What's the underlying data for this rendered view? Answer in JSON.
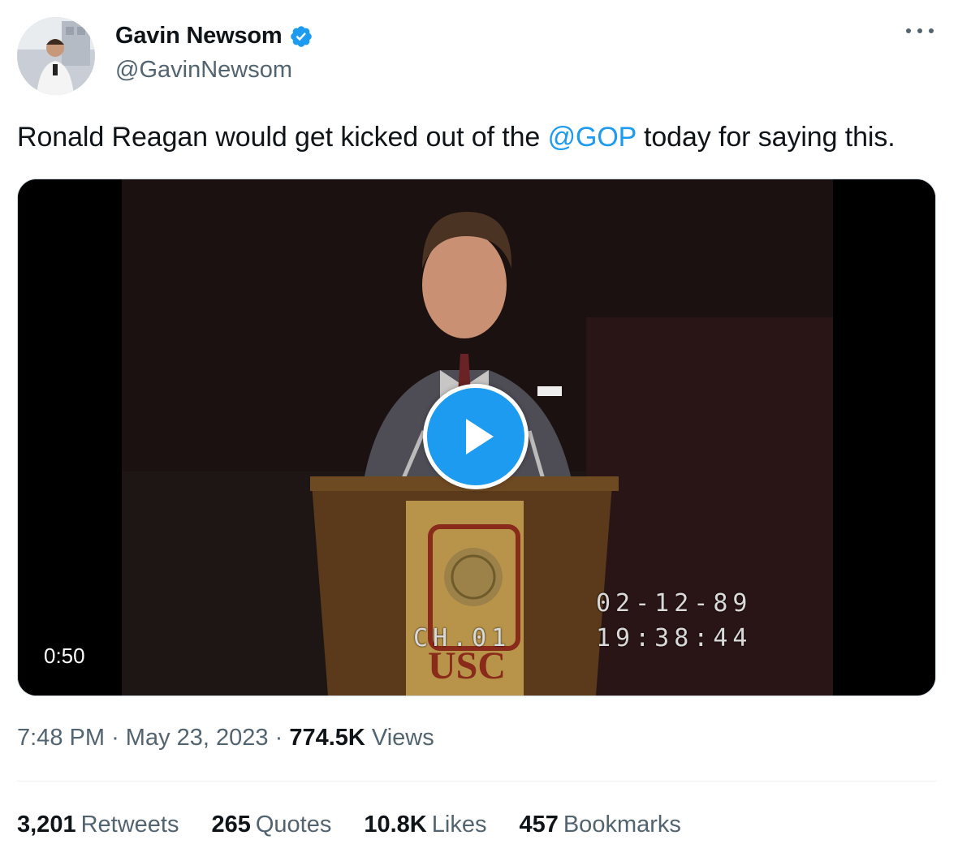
{
  "author": {
    "display_name": "Gavin Newsom",
    "handle": "@GavinNewsom",
    "verified_icon": "verified-badge-icon",
    "avatar_icon": "profile-photo"
  },
  "tweet": {
    "text_before": "Ronald Reagan would get kicked out of the ",
    "mention": "@GOP",
    "text_after": " today for saying this."
  },
  "media": {
    "duration": "0:50",
    "play_icon": "play-icon",
    "overlay": {
      "date": "02-12-89",
      "time": "19:38:44",
      "channel": "CH.01",
      "podium_logo": "USC"
    }
  },
  "meta": {
    "time": "7:48 PM",
    "separator": "·",
    "date": "May 23, 2023",
    "views_count": "774.5K",
    "views_label": "Views"
  },
  "stats": [
    {
      "count": "3,201",
      "label": "Retweets"
    },
    {
      "count": "265",
      "label": "Quotes"
    },
    {
      "count": "10.8K",
      "label": "Likes"
    },
    {
      "count": "457",
      "label": "Bookmarks"
    }
  ],
  "colors": {
    "accent": "#1d9bf0",
    "text": "#0f1419",
    "secondary": "#536471"
  }
}
